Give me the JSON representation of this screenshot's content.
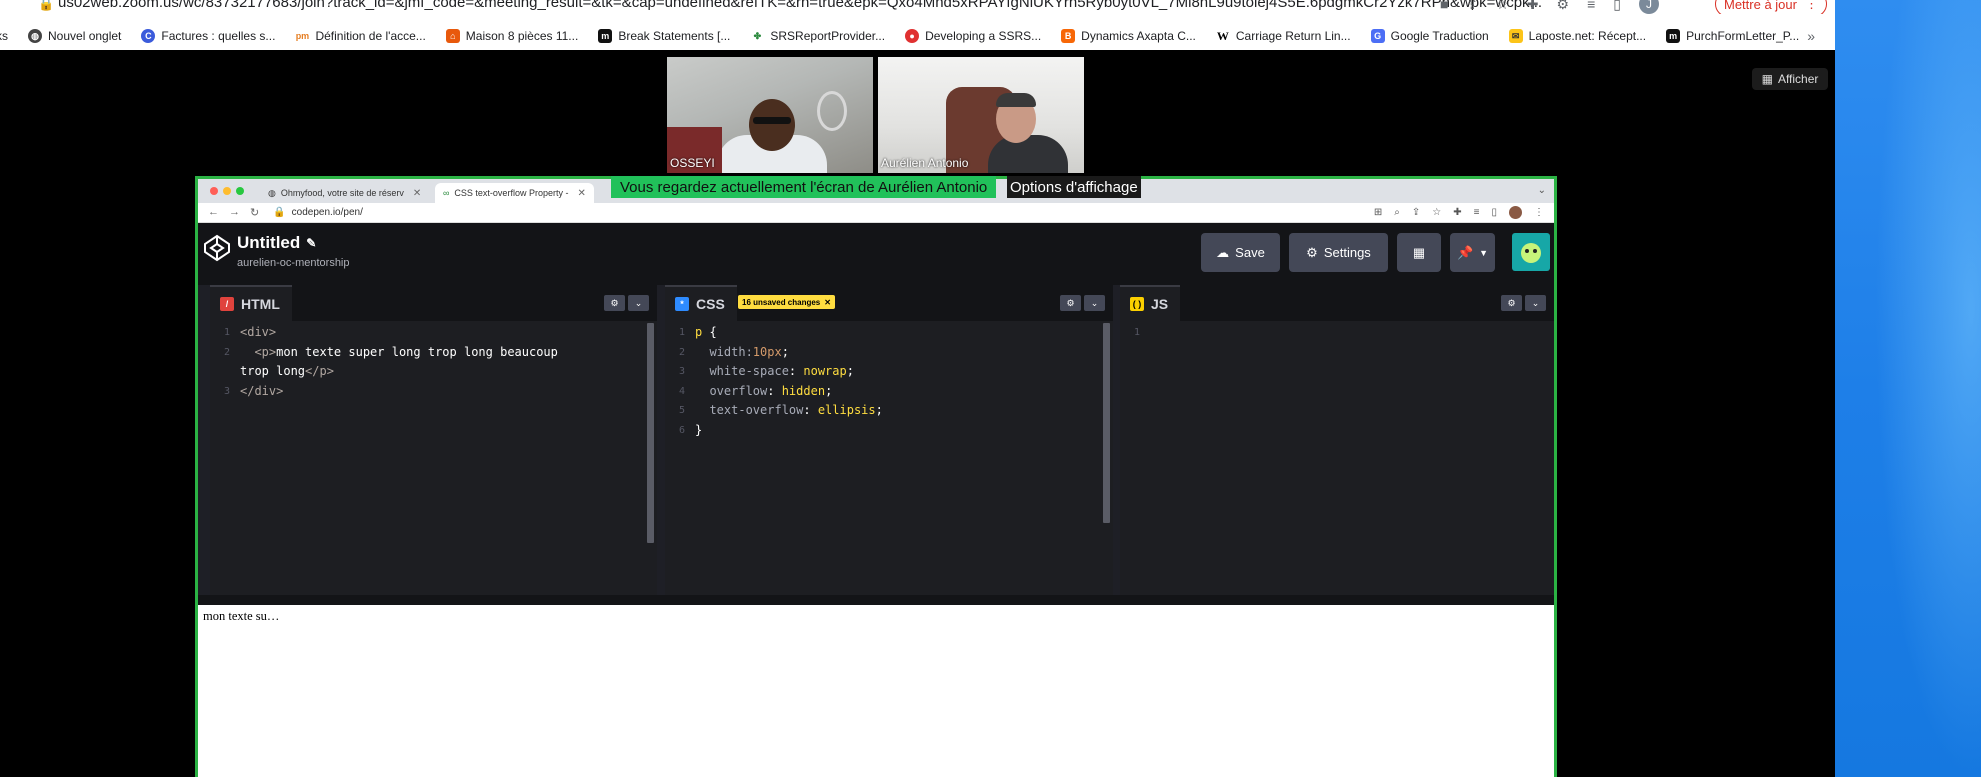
{
  "host_browser": {
    "url": "us02web.zoom.us/wc/83732177683/join?track_id=&jmf_code=&meeting_result=&tk=&cap=undefined&refTK=&rn=true&epk=Qxo4Mnd5xRPAYfgNiUKYrh5Ryb0yt0VL_7Ml8hL9u9tolej4S5E.6pdgmkCr2Yzk7RPn&wpk=wcpk...",
    "avatar_letter": "J",
    "update_label": "Mettre à jour",
    "bookmarks": [
      {
        "label": "ks",
        "icon": "folder-icon"
      },
      {
        "label": "Nouvel onglet",
        "icon": "globe-icon"
      },
      {
        "label": "Factures : quelles s...",
        "icon": "edge-icon"
      },
      {
        "label": "Définition de l'acce...",
        "icon": "pm-icon"
      },
      {
        "label": "Maison 8 pièces 11...",
        "icon": "house-icon"
      },
      {
        "label": "Break Statements [...",
        "icon": "m-icon"
      },
      {
        "label": "SRSReportProvider...",
        "icon": "windows-icon"
      },
      {
        "label": "Developing a SSRS...",
        "icon": "m-red-icon"
      },
      {
        "label": "Dynamics Axapta C...",
        "icon": "blogger-icon"
      },
      {
        "label": "Carriage Return Lin...",
        "icon": "wikipedia-icon"
      },
      {
        "label": "Google Traduction",
        "icon": "translate-icon"
      },
      {
        "label": "Laposte.net: Récept...",
        "icon": "laposte-icon"
      },
      {
        "label": "PurchFormLetter_P...",
        "icon": "m-icon"
      }
    ]
  },
  "zoom": {
    "afficher_label": "Afficher",
    "participants": [
      {
        "name": "OSSEYI"
      },
      {
        "name": "Aurélien Antonio"
      }
    ],
    "share_banner": "Vous regardez actuellement l'écran de Aurélien Antonio",
    "share_options": "Options d'affichage"
  },
  "shared_screen": {
    "tabs": [
      {
        "label": "Ohmyfood, votre site de réserv"
      },
      {
        "label": "CSS text-overflow Property - "
      }
    ],
    "url": "codepen.io/pen/",
    "codepen": {
      "title": "Untitled",
      "user": "aurelien-oc-mentorship",
      "save_label": "Save",
      "settings_label": "Settings",
      "editors": {
        "html": {
          "label": "HTML",
          "lines": [
            {
              "n": "1",
              "parts": [
                {
                  "t": "<div>",
                  "c": "tag"
                }
              ]
            },
            {
              "n": "2",
              "parts": [
                {
                  "t": "  <p>",
                  "c": "tag"
                },
                {
                  "t": "mon texte super long trop long beaucoup",
                  "c": "txt"
                }
              ]
            },
            {
              "n": "",
              "parts": [
                {
                  "t": "trop long",
                  "c": "txt"
                },
                {
                  "t": "</p>",
                  "c": "tag"
                }
              ]
            },
            {
              "n": "3",
              "parts": [
                {
                  "t": "</div>",
                  "c": "tag"
                }
              ]
            }
          ]
        },
        "css": {
          "label": "CSS",
          "unsaved": "16 unsaved changes",
          "lines": [
            {
              "n": "1",
              "parts": [
                {
                  "t": "p ",
                  "c": "sel"
                },
                {
                  "t": "{",
                  "c": "txt"
                }
              ]
            },
            {
              "n": "2",
              "parts": [
                {
                  "t": "  width:",
                  "c": "prop"
                },
                {
                  "t": "10px",
                  "c": "num"
                },
                {
                  "t": ";",
                  "c": "txt"
                }
              ]
            },
            {
              "n": "3",
              "parts": [
                {
                  "t": "  white-space",
                  "c": "prop"
                },
                {
                  "t": ": ",
                  "c": "txt"
                },
                {
                  "t": "nowrap",
                  "c": "val"
                },
                {
                  "t": ";",
                  "c": "txt"
                }
              ]
            },
            {
              "n": "4",
              "parts": [
                {
                  "t": "  overflow",
                  "c": "prop"
                },
                {
                  "t": ": ",
                  "c": "txt"
                },
                {
                  "t": "hidden",
                  "c": "val"
                },
                {
                  "t": ";",
                  "c": "txt"
                }
              ]
            },
            {
              "n": "5",
              "parts": [
                {
                  "t": "  text-overflow",
                  "c": "prop"
                },
                {
                  "t": ": ",
                  "c": "txt"
                },
                {
                  "t": "ellipsis",
                  "c": "val"
                },
                {
                  "t": ";",
                  "c": "txt"
                }
              ]
            },
            {
              "n": "6",
              "parts": [
                {
                  "t": "}",
                  "c": "txt"
                }
              ]
            }
          ]
        },
        "js": {
          "label": "JS",
          "lines": [
            {
              "n": "1",
              "parts": []
            }
          ]
        }
      },
      "result_text": "mon texte su…"
    }
  },
  "colors": {
    "zoom_share_green": "#21c15a",
    "codepen_dark": "#131417",
    "codepen_yellow": "#ffdd40",
    "update_red": "#d93025"
  }
}
